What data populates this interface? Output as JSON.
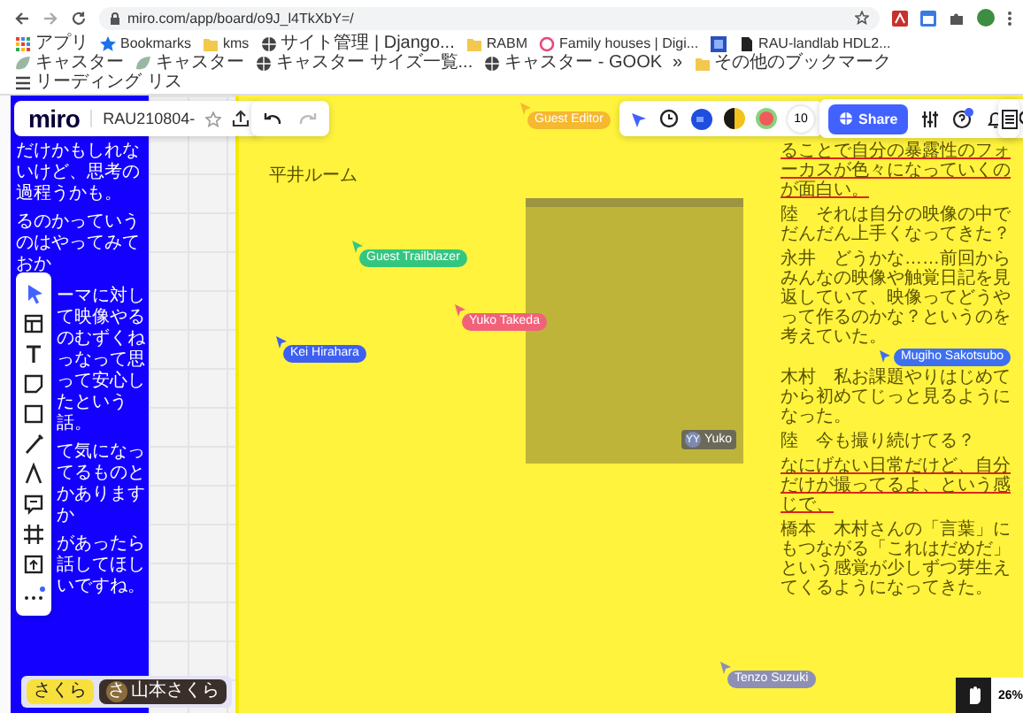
{
  "browser": {
    "url": "miro.com/app/board/o9J_l4TkXbY=/",
    "bookmarks": [
      {
        "kind": "apps",
        "label": "アプリ"
      },
      {
        "kind": "star",
        "label": "Bookmarks"
      },
      {
        "kind": "folder",
        "label": "kms"
      },
      {
        "kind": "globe",
        "label": "サイト管理 | Django..."
      },
      {
        "kind": "folder",
        "label": "RABM"
      },
      {
        "kind": "ring",
        "label": "Family houses | Digi..."
      },
      {
        "kind": "tile"
      },
      {
        "kind": "doc",
        "label": "RAU-landlab HDL2..."
      },
      {
        "kind": "leaf",
        "label": "キャスター"
      },
      {
        "kind": "leaf",
        "label": "キャスター"
      },
      {
        "kind": "globe",
        "label": "キャスター サイズ一覧..."
      },
      {
        "kind": "globe",
        "label": "キャスター - GOOK"
      },
      {
        "kind": "more",
        "label": "»"
      },
      {
        "kind": "folder",
        "label": "その他のブックマーク"
      },
      {
        "kind": "list",
        "label": "リーディング リス"
      }
    ]
  },
  "board": {
    "logo": "miro",
    "name": "RAU210804-",
    "left_notes": [
      {
        "text": "だけかもしれないけど、思考の過程うかも。"
      },
      {
        "text": "るのかっていうのはやってみておか"
      },
      {
        "text": "ーマに対して映像やるのむずくねっなって思って安心したという話。"
      },
      {
        "text": "て気になってるものとかありますか"
      },
      {
        "text": "があったら話してほしいですね。"
      }
    ],
    "center_note": [
      "平井ルーム"
    ],
    "right_notes": [
      {
        "text": "ることで自分の暴露性のフォーカスが色々になっていくのが面白い。",
        "marked": true
      },
      {
        "text": "陸　それは自分の映像の中でだんだん上手くなってきた？",
        "marked": false
      },
      {
        "text": "永井　どうかな……前回からみんなの映像や触覚日記を見返していて、映像ってどうやって作るのかな？というのを考えていた。",
        "marked": false
      },
      {
        "text": "木村　私お課題やりはじめてから初めてじっと見るようになった。",
        "marked": false
      },
      {
        "text": "陸　今も撮り続けてる？",
        "marked": false
      },
      {
        "text": "なにげない日常だけど、自分だけが撮ってるよ、という感じで、",
        "marked": true
      },
      {
        "text": "橋本　木村さんの「言葉」にもつながる「これはだめだ」という感覚が少しずつ芽生えてくるようになってきた。",
        "marked": false
      }
    ],
    "frame": {
      "avatar": "YY",
      "name": "Yuko"
    }
  },
  "cursors": [
    {
      "name": "Guest Editor",
      "color": "#f5b82e"
    },
    {
      "name": "Guest Trailblazer",
      "color": "#34c67f"
    },
    {
      "name": "Yuko Takeda",
      "color": "#f2617a"
    },
    {
      "name": "Kei Hirahara",
      "color": "#3d5ff2"
    },
    {
      "name": "Mugiho Sakotsubo",
      "color": "#3d6ff2"
    },
    {
      "name": "Tenzo Suzuki",
      "color": "#8d8fb5"
    }
  ],
  "collaborators": {
    "count": "10"
  },
  "share": "Share",
  "users": [
    {
      "label": "さくら"
    },
    {
      "avatar": "さ",
      "label": "山本さくら"
    }
  ],
  "zoom": "26%"
}
